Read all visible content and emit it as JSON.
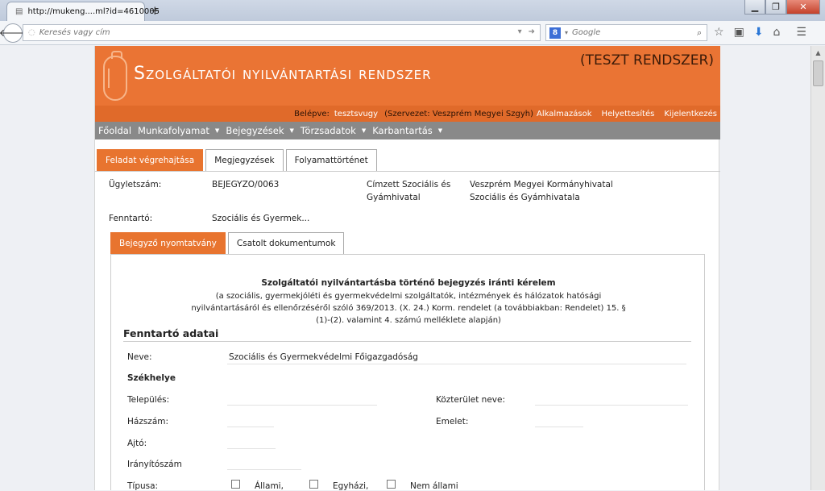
{
  "browser": {
    "tab_title": "http://mukeng....ml?id=4610005",
    "new_tab": "+",
    "address_placeholder": "Keresés vagy cím",
    "search_engine_glyph": "8",
    "search_placeholder": "Google"
  },
  "header": {
    "title": "Szolgáltatói nyilvántartási rendszer",
    "test_label": "(TESZT RENDSZER)",
    "accent_color": "#ea7434"
  },
  "login": {
    "label": "Belépve:",
    "username": "tesztsvugy",
    "organization": "(Szervezet: Veszprém Megyei Szgyh)",
    "links": [
      "Alkalmazások",
      "Helyettesítés",
      "Kijelentkezés"
    ]
  },
  "menu": [
    {
      "label": "Főoldal",
      "has_dropdown": false
    },
    {
      "label": "Munkafolyamat",
      "has_dropdown": true
    },
    {
      "label": "Bejegyzések",
      "has_dropdown": true
    },
    {
      "label": "Törzsadatok",
      "has_dropdown": true
    },
    {
      "label": "Karbantartás",
      "has_dropdown": true
    }
  ],
  "tabs": [
    "Feladat végrehajtása",
    "Megjegyzések",
    "Folyamattörténet"
  ],
  "case": {
    "case_number_label": "Ügyletszám:",
    "case_number": "BEJEGYZO/0063",
    "recipient_label_line1": "Címzett Szociális és",
    "recipient_label_line2": "Gyámhivatal",
    "recipient_line1": "Veszprém Megyei Kormányhivatal",
    "recipient_line2": "Szociális és Gyámhivatala",
    "maintainer_label": "Fenntartó:",
    "maintainer": "Szociális és Gyermek..."
  },
  "subtabs": [
    "Bejegyző nyomtatvány",
    "Csatolt dokumentumok"
  ],
  "form": {
    "title": "Szolgáltatói nyilvántartásba történő bejegyzés iránti kérelem",
    "subtitle_lines": [
      "(a szociális, gyermekjóléti és gyermekvédelmi szolgáltatók, intézmények és hálózatok hatósági",
      "nyilvántartásáról és ellenőrzéséről szóló 369/2013. (X. 24.) Korm. rendelet (a továbbiakban: Rendelet) 15. §",
      "(1)-(2). valamint 4. számú melléklete alapján)"
    ],
    "section_title": "Fenntartó adatai",
    "name_label": "Neve:",
    "name_value": "Szociális és Gyermekvédelmi Főigazgadóság",
    "seat_title": "Székhelye",
    "city_label": "Település:",
    "street_label": "Közterület neve:",
    "house_label": "Házszám:",
    "floor_label": "Emelet:",
    "door_label": "Ajtó:",
    "zip_label": "Irányítószám",
    "type_label": "Típusa:",
    "type_options": [
      "Állami,",
      "Egyházi,",
      "Nem állami"
    ]
  }
}
